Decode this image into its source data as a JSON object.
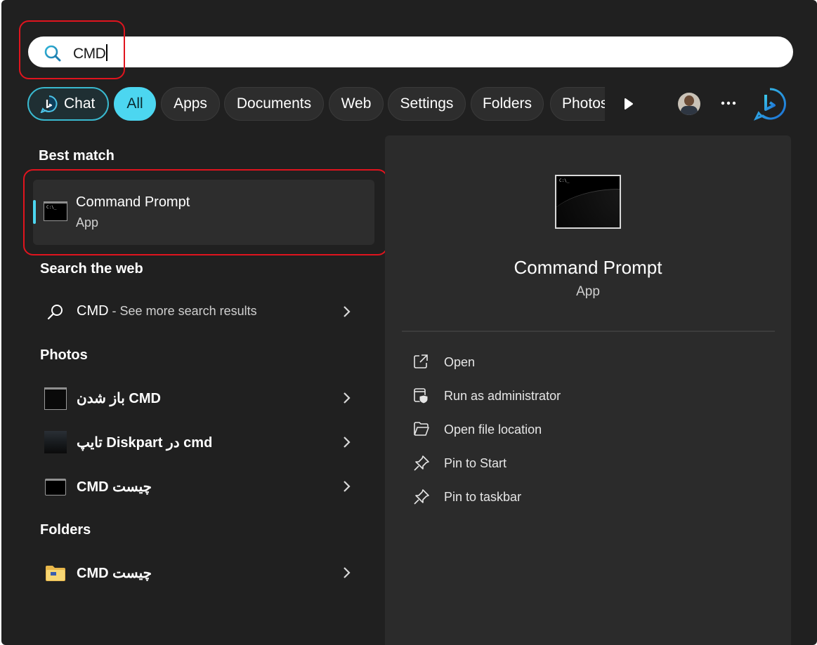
{
  "search": {
    "query": "CMD"
  },
  "filters": [
    "Chat",
    "All",
    "Apps",
    "Documents",
    "Web",
    "Settings",
    "Folders",
    "Photos"
  ],
  "best_match": {
    "title": "Best match",
    "item": {
      "name": "Command Prompt",
      "type": "App"
    }
  },
  "web": {
    "title": "Search the web",
    "query": "CMD",
    "suffix": " - See more search results"
  },
  "photos": {
    "title": "Photos",
    "items": [
      "باز شدن CMD",
      "تایپ Diskpart در cmd",
      "CMD چیست"
    ]
  },
  "folders": {
    "title": "Folders",
    "items": [
      "CMD چیست"
    ]
  },
  "details": {
    "name": "Command Prompt",
    "type": "App",
    "actions": [
      "Open",
      "Run as administrator",
      "Open file location",
      "Pin to Start",
      "Pin to taskbar"
    ]
  },
  "colors": {
    "accent": "#4cd6f0",
    "annotation": "#e0141e",
    "panel": "#202020"
  }
}
